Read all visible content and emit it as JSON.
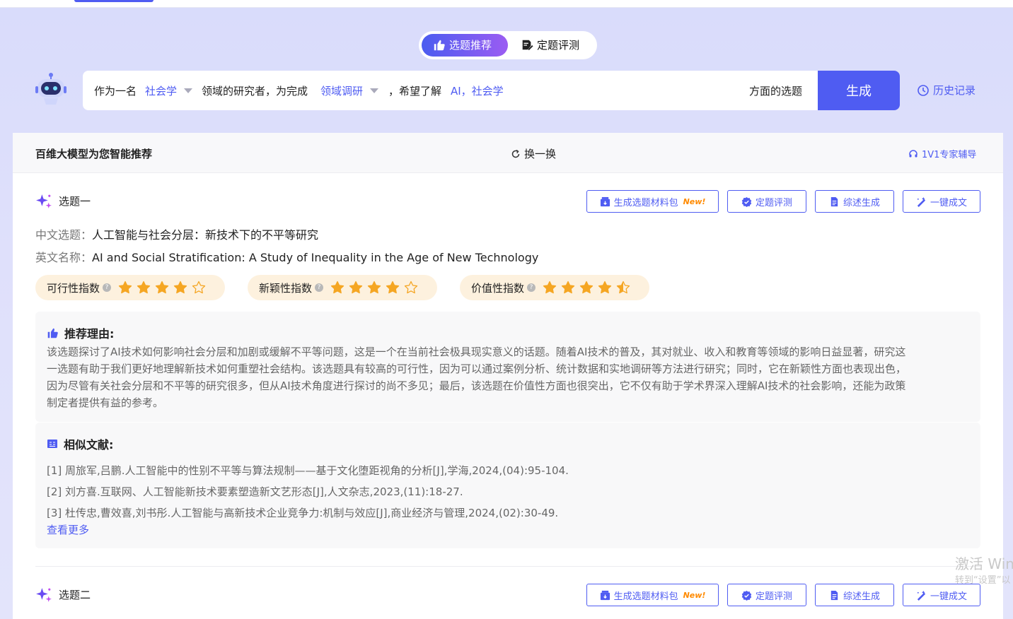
{
  "modes": {
    "active": "选题推荐",
    "inactive": "定题评测"
  },
  "prompt": {
    "prefix": "作为一名",
    "field": "社会学",
    "middle": "领域的研究者，为完成",
    "task": "领域调研",
    "suffix": "，希望了解",
    "topics": "AI，社会学",
    "tail": "方面的选题",
    "generate_label": "生成",
    "history_label": "历史记录"
  },
  "panel": {
    "title": "百维大模型为您智能推荐",
    "refresh_label": "换一换",
    "expert_label": "1V1专家辅导"
  },
  "actions": {
    "material_pack": "生成选题材料包",
    "new_tag": "New!",
    "evaluate": "定题评测",
    "review": "综述生成",
    "one_click": "一键成文"
  },
  "topic1": {
    "heading": "选题一",
    "cn_label": "中文选题：",
    "cn_title": "人工智能与社会分层：新技术下的不平等研究",
    "en_label": "英文名称：",
    "en_title": "AI and Social Stratification: A Study of Inequality in the Age of New Technology",
    "scores": [
      {
        "label": "可行性指数",
        "stars": 4
      },
      {
        "label": "新颖性指数",
        "stars": 4
      },
      {
        "label": "价值性指数",
        "stars": 4.5
      }
    ],
    "reason_title": "推荐理由:",
    "reason_lines": [
      "该选题探讨了AI技术如何影响社会分层和加剧或缓解不平等问题，这是一个在当前社会极具现实意义的话题。随着AI技术的普及，其对就业、收入和教育等领域的影响日益显著，研究这",
      "一选题有助于我们更好地理解新技术如何重塑社会结构。该选题具有较高的可行性，因为可以通过案例分析、统计数据和实地调研等方法进行研究；同时，它在新颖性方面也表现出色，",
      "因为尽管有关社会分层和不平等的研究很多，但从AI技术角度进行探讨的尚不多见；最后，该选题在价值性方面也很突出，它不仅有助于学术界深入理解AI技术的社会影响，还能为政策",
      "制定者提供有益的参考。"
    ],
    "refs_title": "相似文献:",
    "refs": [
      "[1] 周旅军,吕鹏.人工智能中的性别不平等与算法规制——基于文化堕距视角的分析[J],学海,2024,(04):95-104.",
      "[2] 刘方喜.互联网、人工智能新技术要素塑造新文艺形态[J],人文杂志,2023,(11):18-27.",
      "[3] 杜传忠,曹效喜,刘书彤.人工智能与高新技术企业竞争力:机制与效应[J],商业经济与管理,2024,(02):30-49."
    ],
    "see_more": "查看更多"
  },
  "topic2": {
    "heading": "选题二"
  },
  "watermark": {
    "line1": "激活 Win",
    "line2": "转到“设置”以"
  },
  "colors": {
    "accent": "#4f5cf2",
    "star": "#f5a623",
    "pill_bg": "#fdf1de"
  }
}
